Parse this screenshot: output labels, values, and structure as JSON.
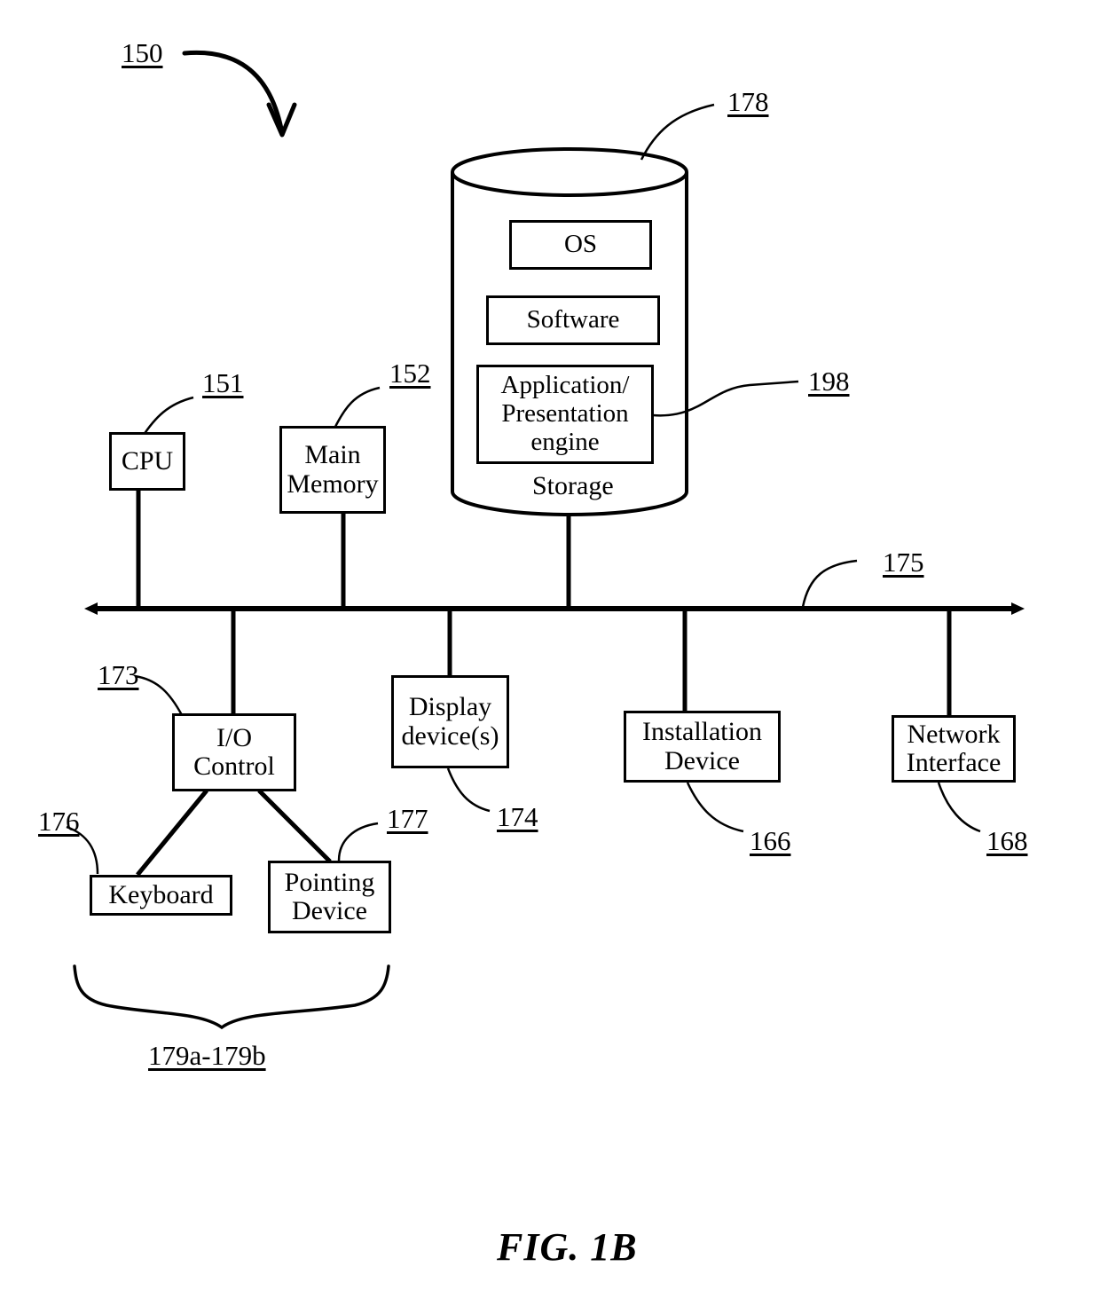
{
  "figure": {
    "caption": "FIG. 1B",
    "system_ref": "150"
  },
  "bus": {
    "ref": "175"
  },
  "storage": {
    "ref": "178",
    "label": "Storage",
    "contents": [
      {
        "label": "OS",
        "ref": ""
      },
      {
        "label": "Software",
        "ref": ""
      },
      {
        "label": "Application/\nPresentation\nengine",
        "ref": "198"
      }
    ],
    "app_engine_line1": "Application/",
    "app_engine_line2": "Presentation",
    "app_engine_line3": "engine",
    "app_engine_ref": "198",
    "os_label": "OS",
    "software_label": "Software"
  },
  "components": {
    "cpu": {
      "label": "CPU",
      "ref": "151"
    },
    "main_memory": {
      "line1": "Main",
      "line2": "Memory",
      "ref": "152"
    },
    "io_control": {
      "line1": "I/O",
      "line2": "Control",
      "ref": "173"
    },
    "display_devices": {
      "line1": "Display",
      "line2": "device(s)",
      "ref": "174"
    },
    "installation_device": {
      "line1": "Installation",
      "line2": "Device",
      "ref": "166"
    },
    "network_interface": {
      "line1": "Network",
      "line2": "Interface",
      "ref": "168"
    },
    "keyboard": {
      "label": "Keyboard",
      "ref": "176"
    },
    "pointing_device": {
      "line1": "Pointing",
      "line2": "Device",
      "ref": "177"
    }
  },
  "io_devices_group": {
    "ref": "179a-179b"
  },
  "colors": {
    "ink": "#000000",
    "paper": "#ffffff"
  }
}
